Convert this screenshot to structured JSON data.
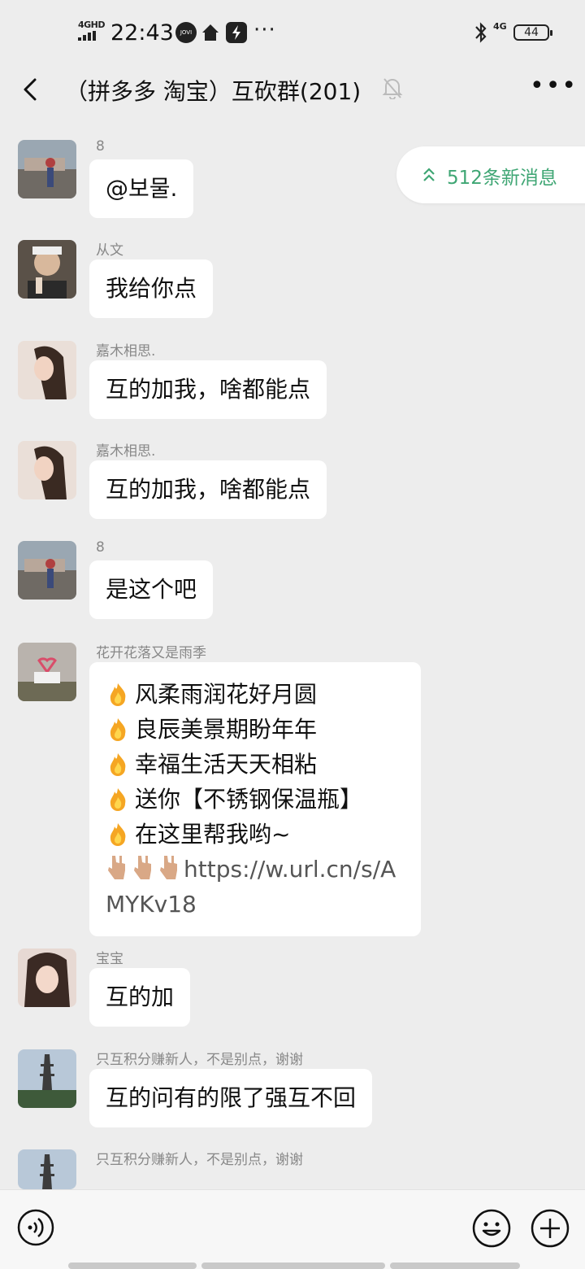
{
  "status_bar": {
    "network_left": "4GHD",
    "time": "22:43",
    "app_icon_label": "JOVI",
    "more_dots": "···",
    "network_right": "4G",
    "battery": "44"
  },
  "header": {
    "title": "（拼多多 淘宝）互砍群(201)"
  },
  "new_messages_pill": {
    "text": "512条新消息",
    "accent_color": "#3fa674"
  },
  "messages": [
    {
      "sender": "8",
      "text": "@보물."
    },
    {
      "sender": "从文",
      "text": "我给你点"
    },
    {
      "sender": "嘉木相思.",
      "text": "互的加我，啥都能点"
    },
    {
      "sender": "嘉木相思.",
      "text": "互的加我，啥都能点"
    },
    {
      "sender": "8",
      "text": "是这个吧"
    },
    {
      "sender": "花开花落又是雨季",
      "lines": [
        "风柔雨润花好月圆",
        "良辰美景期盼年年",
        "幸福生活天天相粘",
        "送你【不锈钢保温瓶】",
        "在这里帮我哟~"
      ],
      "link": "https://w.url.cn/s/AMYKv18"
    },
    {
      "sender": "宝宝",
      "text": "互的加"
    },
    {
      "sender": "只互积分赚新人，不是别点，谢谢",
      "text": "互的问有的限了强互不回"
    },
    {
      "sender": "只互积分赚新人，不是别点，谢谢",
      "text": ""
    }
  ],
  "input_bar": {
    "placeholder": "",
    "icons": [
      "voice-icon",
      "emoji-icon",
      "plus-icon"
    ]
  },
  "colors": {
    "background": "#ededed",
    "bubble": "#ffffff",
    "sender_name": "#888888"
  }
}
